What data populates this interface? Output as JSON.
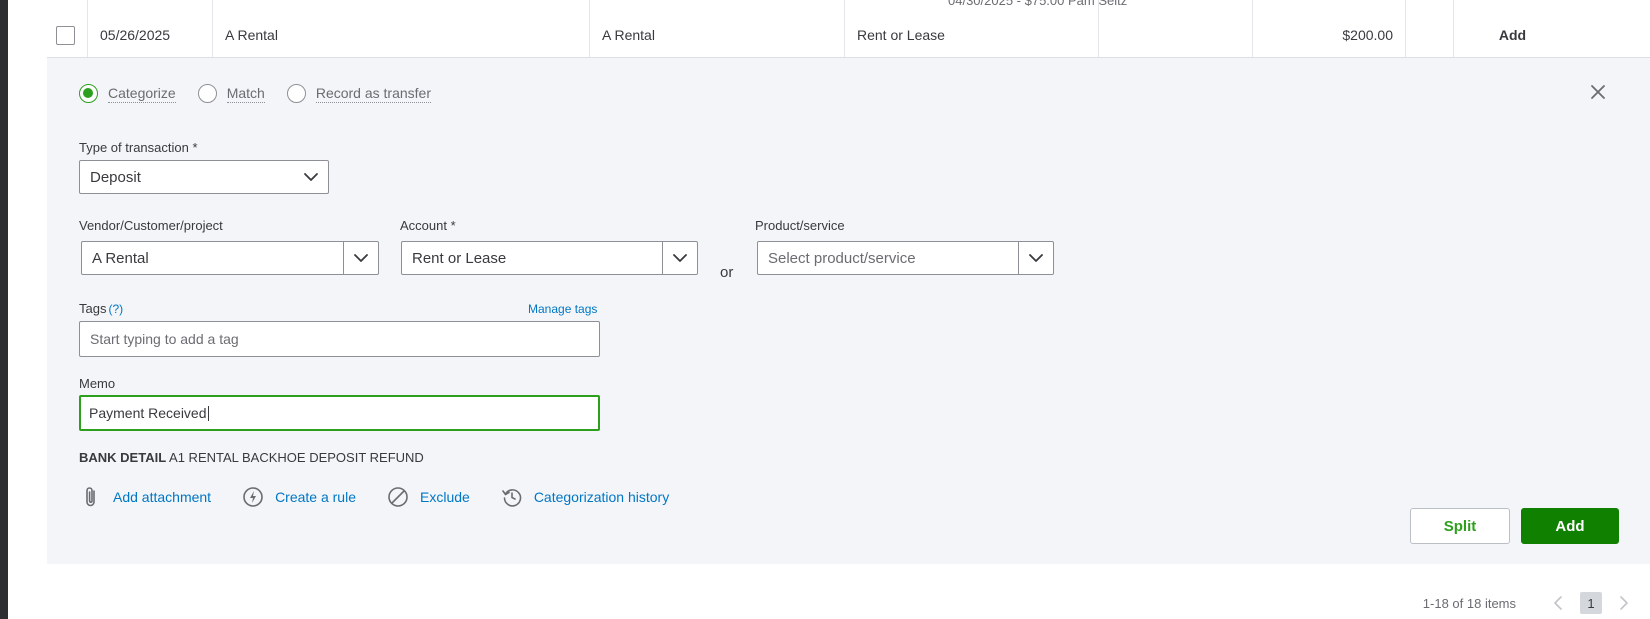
{
  "previous_row": {
    "partial_text": "04/30/2025 - $75.00 Pam Seitz"
  },
  "row": {
    "date": "05/26/2025",
    "description": "A Rental",
    "payee": "A Rental",
    "category": "Rent or Lease",
    "spent": "",
    "received": "$200.00",
    "action_label": "Add"
  },
  "panel": {
    "radios": [
      {
        "label": "Categorize",
        "checked": true
      },
      {
        "label": "Match",
        "checked": false
      },
      {
        "label": "Record as transfer",
        "checked": false
      }
    ],
    "type_of_transaction": {
      "label": "Type of transaction *",
      "value": "Deposit"
    },
    "vendor": {
      "label": "Vendor/Customer/project",
      "value": "A Rental"
    },
    "account": {
      "label": "Account *",
      "value": "Rent or Lease"
    },
    "or_label": "or",
    "product": {
      "label": "Product/service",
      "placeholder": "Select product/service"
    },
    "tags": {
      "label": "Tags",
      "help": "(?)",
      "manage": "Manage tags",
      "placeholder": "Start typing to add a tag"
    },
    "memo": {
      "label": "Memo",
      "value": "Payment Received"
    },
    "bank_detail": {
      "label": "BANK DETAIL",
      "value": "A1 RENTAL BACKHOE DEPOSIT REFUND"
    },
    "actions": {
      "attachment": "Add attachment",
      "rule": "Create a rule",
      "exclude": "Exclude",
      "history": "Categorization history"
    },
    "buttons": {
      "split": "Split",
      "add": "Add"
    }
  },
  "pagination": {
    "summary": "1-18 of 18 items",
    "current_page": "1"
  },
  "colors": {
    "accent_green": "#2ca01c",
    "button_green": "#108000",
    "link_blue": "#0077c5",
    "panel_bg": "#f4f5f8"
  }
}
